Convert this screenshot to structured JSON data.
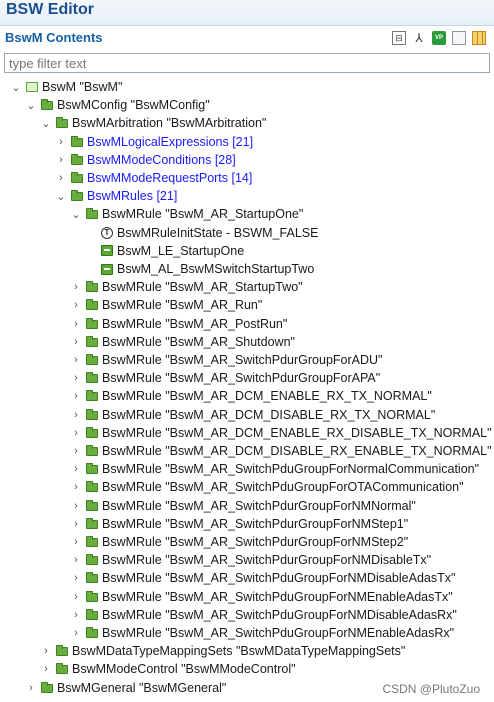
{
  "editor": {
    "title": "BSW Editor"
  },
  "section": {
    "title": "BswM Contents"
  },
  "toolbar": [
    {
      "name": "collapse-all-button",
      "icon": "collapse-icon",
      "glyph": "⊟"
    },
    {
      "name": "filter-button",
      "icon": "filter-icon",
      "glyph": "⅄"
    },
    {
      "name": "vp-button",
      "icon": "vp-icon",
      "glyph": "VP"
    },
    {
      "name": "document-button",
      "icon": "document-icon",
      "glyph": ""
    },
    {
      "name": "table-button",
      "icon": "table-icon",
      "glyph": ""
    }
  ],
  "filter": {
    "placeholder": "type filter text",
    "value": ""
  },
  "tree": [
    {
      "label": "BswM \"BswM\"",
      "depth": 0,
      "state": "expanded",
      "icon": "module-icon",
      "blue": false
    },
    {
      "label": "BswMConfig \"BswMConfig\"",
      "depth": 1,
      "state": "expanded",
      "icon": "folder-icon",
      "blue": false
    },
    {
      "label": "BswMArbitration \"BswMArbitration\"",
      "depth": 2,
      "state": "expanded",
      "icon": "folder-icon",
      "blue": false
    },
    {
      "label": "BswMLogicalExpressions [21]",
      "depth": 3,
      "state": "collapsed",
      "icon": "folder-icon",
      "blue": true
    },
    {
      "label": "BswMModeConditions [28]",
      "depth": 3,
      "state": "collapsed",
      "icon": "folder-icon",
      "blue": true
    },
    {
      "label": "BswMModeRequestPorts [14]",
      "depth": 3,
      "state": "collapsed",
      "icon": "folder-icon",
      "blue": true
    },
    {
      "label": "BswMRules [21]",
      "depth": 3,
      "state": "expanded",
      "icon": "folder-icon",
      "blue": true
    },
    {
      "label": "BswMRule \"BswM_AR_StartupOne\"",
      "depth": 4,
      "state": "expanded",
      "icon": "folder-icon",
      "blue": false
    },
    {
      "label": "BswMRuleInitState - BSWM_FALSE",
      "depth": 5,
      "state": "leaf",
      "icon": "text-param-icon",
      "blue": false
    },
    {
      "label": "BswM_LE_StartupOne",
      "depth": 5,
      "state": "leaf",
      "icon": "reference-icon",
      "blue": false
    },
    {
      "label": "BswM_AL_BswMSwitchStartupTwo",
      "depth": 5,
      "state": "leaf",
      "icon": "reference-icon",
      "blue": false
    },
    {
      "label": "BswMRule \"BswM_AR_StartupTwo\"",
      "depth": 4,
      "state": "collapsed",
      "icon": "folder-icon",
      "blue": false
    },
    {
      "label": "BswMRule \"BswM_AR_Run\"",
      "depth": 4,
      "state": "collapsed",
      "icon": "folder-icon",
      "blue": false
    },
    {
      "label": "BswMRule \"BswM_AR_PostRun\"",
      "depth": 4,
      "state": "collapsed",
      "icon": "folder-icon",
      "blue": false
    },
    {
      "label": "BswMRule \"BswM_AR_Shutdown\"",
      "depth": 4,
      "state": "collapsed",
      "icon": "folder-icon",
      "blue": false
    },
    {
      "label": "BswMRule \"BswM_AR_SwitchPdurGroupForADU\"",
      "depth": 4,
      "state": "collapsed",
      "icon": "folder-icon",
      "blue": false
    },
    {
      "label": "BswMRule \"BswM_AR_SwitchPdurGroupForAPA\"",
      "depth": 4,
      "state": "collapsed",
      "icon": "folder-icon",
      "blue": false
    },
    {
      "label": "BswMRule \"BswM_AR_DCM_ENABLE_RX_TX_NORMAL\"",
      "depth": 4,
      "state": "collapsed",
      "icon": "folder-icon",
      "blue": false
    },
    {
      "label": "BswMRule \"BswM_AR_DCM_DISABLE_RX_TX_NORMAL\"",
      "depth": 4,
      "state": "collapsed",
      "icon": "folder-icon",
      "blue": false
    },
    {
      "label": "BswMRule \"BswM_AR_DCM_ENABLE_RX_DISABLE_TX_NORMAL\"",
      "depth": 4,
      "state": "collapsed",
      "icon": "folder-icon",
      "blue": false
    },
    {
      "label": "BswMRule \"BswM_AR_DCM_DISABLE_RX_ENABLE_TX_NORMAL\"",
      "depth": 4,
      "state": "collapsed",
      "icon": "folder-icon",
      "blue": false
    },
    {
      "label": "BswMRule \"BswM_AR_SwitchPduGroupForNormalCommunication\"",
      "depth": 4,
      "state": "collapsed",
      "icon": "folder-icon",
      "blue": false
    },
    {
      "label": "BswMRule \"BswM_AR_SwitchPduGroupForOTACommunication\"",
      "depth": 4,
      "state": "collapsed",
      "icon": "folder-icon",
      "blue": false
    },
    {
      "label": "BswMRule \"BswM_AR_SwitchPdurGroupForNMNormal\"",
      "depth": 4,
      "state": "collapsed",
      "icon": "folder-icon",
      "blue": false
    },
    {
      "label": "BswMRule \"BswM_AR_SwitchPdurGroupForNMStep1\"",
      "depth": 4,
      "state": "collapsed",
      "icon": "folder-icon",
      "blue": false
    },
    {
      "label": "BswMRule \"BswM_AR_SwitchPdurGroupForNMStep2\"",
      "depth": 4,
      "state": "collapsed",
      "icon": "folder-icon",
      "blue": false
    },
    {
      "label": "BswMRule \"BswM_AR_SwitchPdurGroupForNMDisableTx\"",
      "depth": 4,
      "state": "collapsed",
      "icon": "folder-icon",
      "blue": false
    },
    {
      "label": "BswMRule \"BswM_AR_SwitchPduGroupForNMDisableAdasTx\"",
      "depth": 4,
      "state": "collapsed",
      "icon": "folder-icon",
      "blue": false
    },
    {
      "label": "BswMRule \"BswM_AR_SwitchPduGroupForNMEnableAdasTx\"",
      "depth": 4,
      "state": "collapsed",
      "icon": "folder-icon",
      "blue": false
    },
    {
      "label": "BswMRule \"BswM_AR_SwitchPduGroupForNMDisableAdasRx\"",
      "depth": 4,
      "state": "collapsed",
      "icon": "folder-icon",
      "blue": false
    },
    {
      "label": "BswMRule \"BswM_AR_SwitchPduGroupForNMEnableAdasRx\"",
      "depth": 4,
      "state": "collapsed",
      "icon": "folder-icon",
      "blue": false
    },
    {
      "label": "BswMDataTypeMappingSets \"BswMDataTypeMappingSets\"",
      "depth": 2,
      "state": "collapsed",
      "icon": "folder-icon",
      "blue": false
    },
    {
      "label": "BswMModeControl \"BswMModeControl\"",
      "depth": 2,
      "state": "collapsed",
      "icon": "folder-icon",
      "blue": false
    },
    {
      "label": "BswMGeneral \"BswMGeneral\"",
      "depth": 1,
      "state": "collapsed",
      "icon": "folder-icon",
      "blue": false
    }
  ],
  "watermark": "CSDN @PlutoZuo"
}
